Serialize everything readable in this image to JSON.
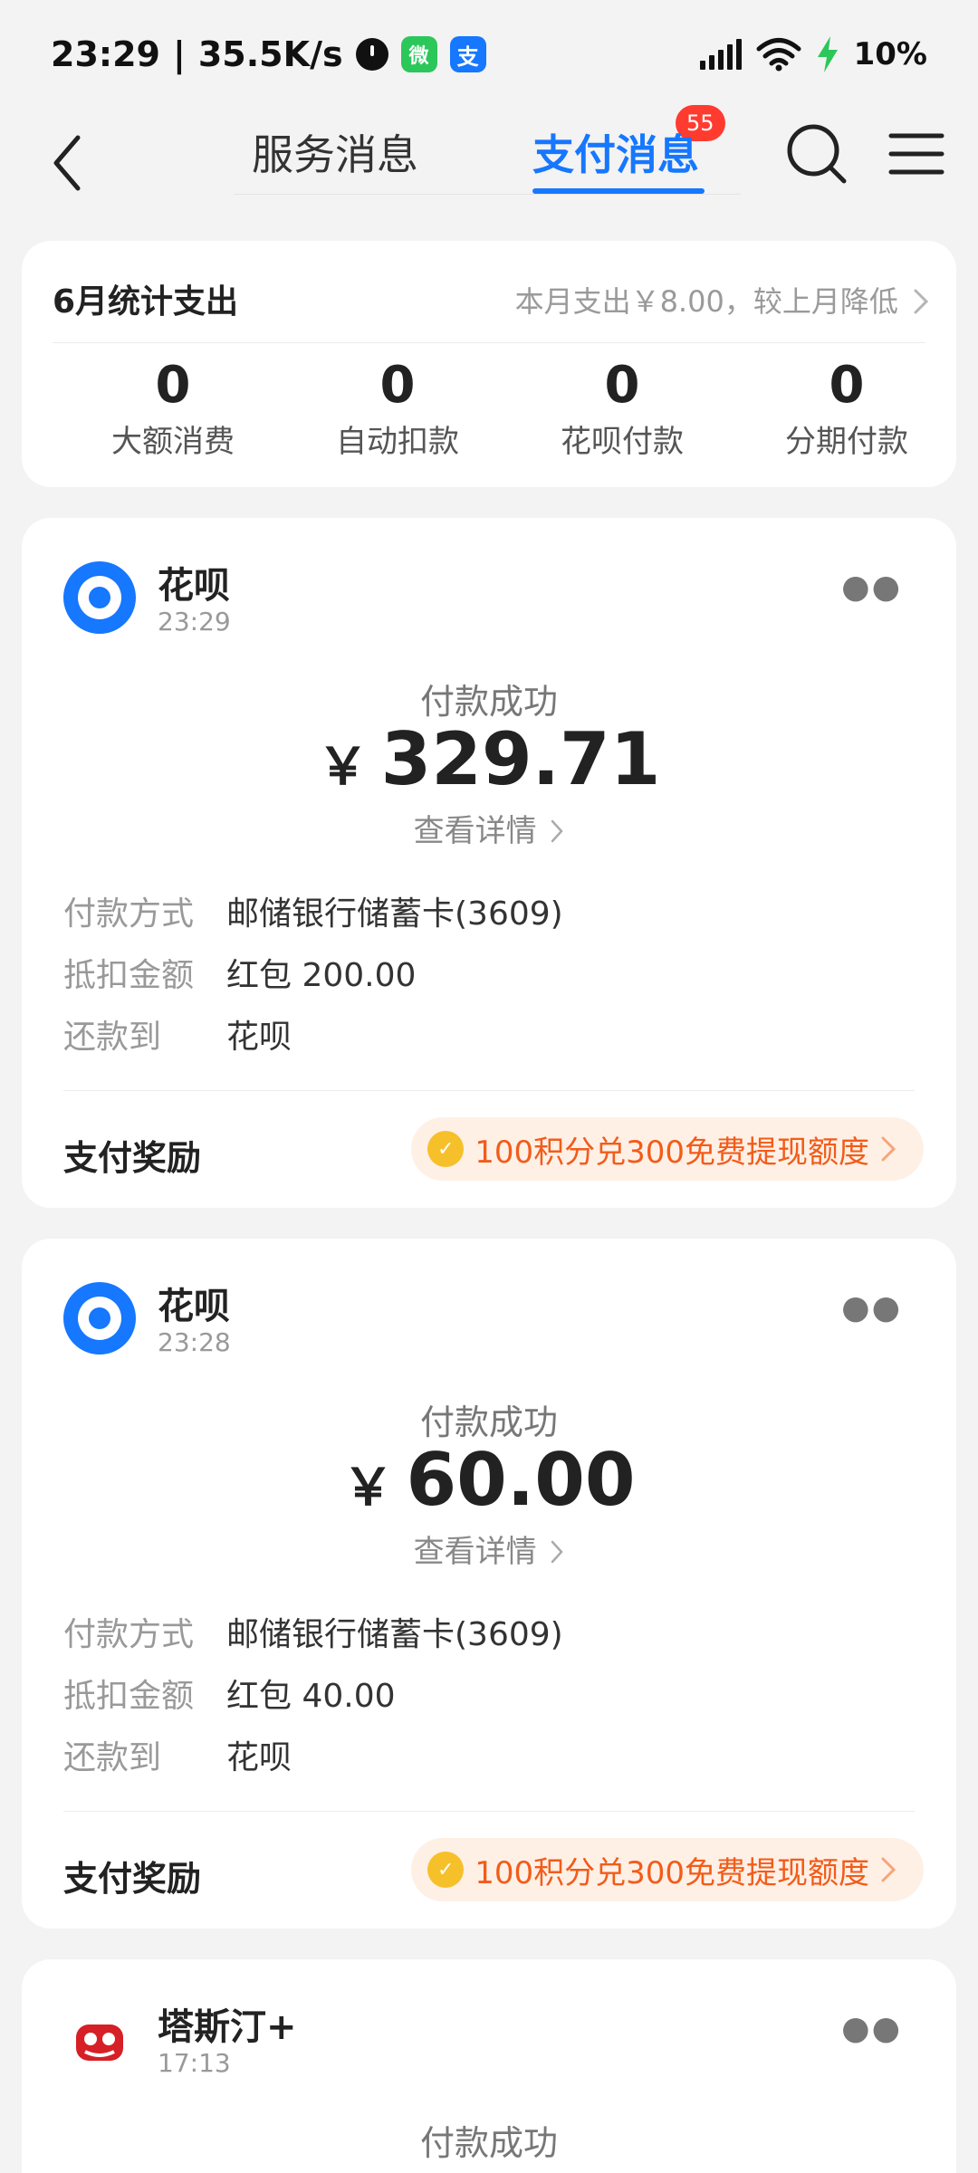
{
  "status_bar": {
    "time": "23:29",
    "net_speed": "35.5K/s",
    "battery": "10%",
    "wechat_glyph": "微",
    "alipay_glyph": "支"
  },
  "nav": {
    "tab_service": "服务消息",
    "service_badge": "55",
    "tab_pay": "支付消息"
  },
  "summary": {
    "title": "6月统计支出",
    "link": "本月支出￥8.00，较上月降低",
    "stats": [
      {
        "value": "0",
        "label": "大额消费"
      },
      {
        "value": "0",
        "label": "自动扣款"
      },
      {
        "value": "0",
        "label": "花呗付款"
      },
      {
        "value": "0",
        "label": "分期付款"
      }
    ]
  },
  "cards": [
    {
      "merchant": "花呗",
      "time": "23:29",
      "status": "付款成功",
      "currency": "￥",
      "amount": "329.71",
      "detail_link": "查看详情",
      "rows": [
        {
          "label": "付款方式",
          "value": "邮储银行储蓄卡(3609)"
        },
        {
          "label": "抵扣金额",
          "value": "红包 200.00"
        },
        {
          "label": "还款到",
          "value": "花呗"
        }
      ],
      "reward_label": "支付奖励",
      "reward_text": "100积分兑300免费提现额度"
    },
    {
      "merchant": "花呗",
      "time": "23:28",
      "status": "付款成功",
      "currency": "￥",
      "amount": "60.00",
      "detail_link": "查看详情",
      "rows": [
        {
          "label": "付款方式",
          "value": "邮储银行储蓄卡(3609)"
        },
        {
          "label": "抵扣金额",
          "value": "红包 40.00"
        },
        {
          "label": "还款到",
          "value": "花呗"
        }
      ],
      "reward_label": "支付奖励",
      "reward_text": "100积分兑300免费提现额度"
    },
    {
      "merchant": "塔斯汀+",
      "time": "17:13",
      "status": "付款成功"
    }
  ],
  "colors": {
    "accent": "#1677ff",
    "badge": "#ff3b30",
    "reward": "#f25c1a"
  },
  "icons": [
    "back-icon",
    "search-icon",
    "menu-icon",
    "alarm-icon",
    "wechat-icon",
    "alipay-icon",
    "signal-icon",
    "wifi-icon",
    "charging-icon",
    "more-icon",
    "huabei-logo-icon",
    "tastien-logo-icon",
    "coin-icon",
    "chevron-right-icon"
  ]
}
